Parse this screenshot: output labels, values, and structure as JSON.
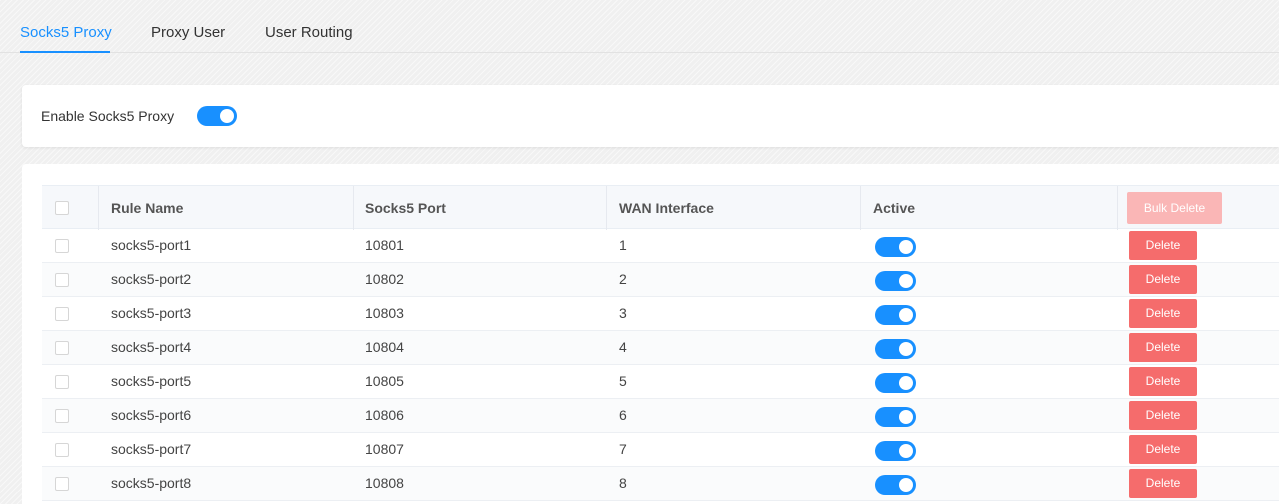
{
  "tabs": [
    {
      "label": "Socks5 Proxy",
      "active": true
    },
    {
      "label": "Proxy User",
      "active": false
    },
    {
      "label": "User Routing",
      "active": false
    }
  ],
  "enable": {
    "label": "Enable Socks5 Proxy",
    "enabled": true
  },
  "table": {
    "headers": {
      "rule_name": "Rule Name",
      "port": "Socks5 Port",
      "wan": "WAN Interface",
      "active": "Active",
      "bulk_delete": "Bulk Delete"
    },
    "delete_label": "Delete",
    "rows": [
      {
        "name": "socks5-port1",
        "port": "10801",
        "wan": "1",
        "active": true
      },
      {
        "name": "socks5-port2",
        "port": "10802",
        "wan": "2",
        "active": true
      },
      {
        "name": "socks5-port3",
        "port": "10803",
        "wan": "3",
        "active": true
      },
      {
        "name": "socks5-port4",
        "port": "10804",
        "wan": "4",
        "active": true
      },
      {
        "name": "socks5-port5",
        "port": "10805",
        "wan": "5",
        "active": true
      },
      {
        "name": "socks5-port6",
        "port": "10806",
        "wan": "6",
        "active": true
      },
      {
        "name": "socks5-port7",
        "port": "10807",
        "wan": "7",
        "active": true
      },
      {
        "name": "socks5-port8",
        "port": "10808",
        "wan": "8",
        "active": true
      }
    ]
  },
  "colors": {
    "accent": "#1890ff",
    "danger": "#f56c6c",
    "danger_disabled": "#fab6b6"
  }
}
